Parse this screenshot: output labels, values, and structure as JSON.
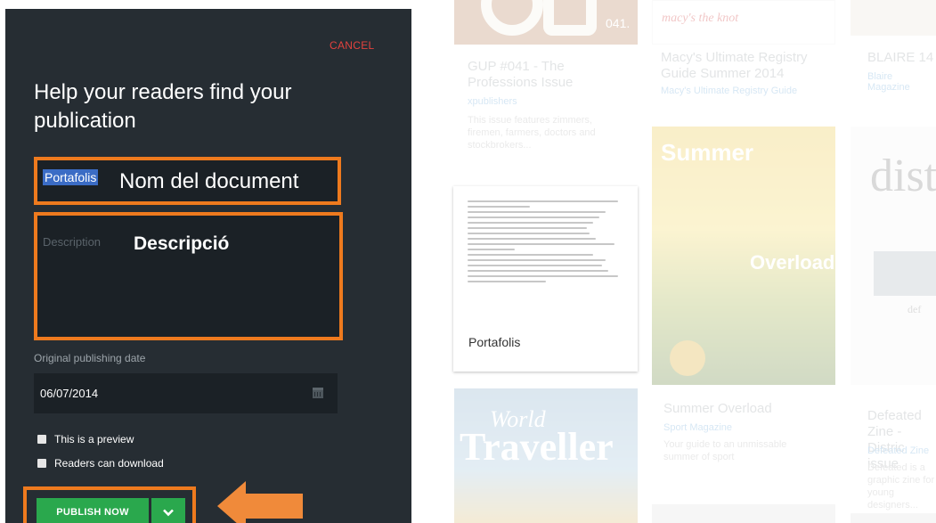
{
  "dialog": {
    "cancel_label": "CANCEL",
    "title": "Help your readers find your publication",
    "name_value": "Portafolis",
    "name_annotation": "Nom del document",
    "description_placeholder": "Description",
    "description_annotation": "Descripció",
    "date_label": "Original publishing date",
    "date_value": "06/07/2014",
    "checkbox_preview": "This is a preview",
    "checkbox_download": "Readers can download",
    "publish_label": "PUBLISH NOW"
  },
  "background_cards": [
    {
      "cover_text": "041.",
      "title": "GUP #041 - The Professions Issue",
      "publisher": "xpublishers",
      "description": "This issue features zimmers, firemen, farmers, doctors and stockbrokers..."
    },
    {
      "cover_text": "macy's the knot",
      "title": "Macy's Ultimate Registry Guide Summer 2014",
      "publisher": "Macy's Ultimate Registry Guide"
    },
    {
      "title": "BLAIRE 14",
      "publisher": "Blaire Magazine"
    },
    {
      "cover_text": "Summer",
      "cover_text2": "Overload",
      "title": "Summer Overload",
      "publisher": "Sport Magazine",
      "description": "Your guide to an unmissable summer of sport"
    },
    {
      "cover_text": "dist",
      "cover_text2": "def",
      "title": "Defeated Zine - Distric issue",
      "publisher": "Defeated Zine",
      "description": "Defeated is a graphic zine for young designers..."
    },
    {
      "cover_text": "World",
      "cover_text2": "Traveller"
    }
  ],
  "document_card": {
    "name": "Portafolis"
  },
  "colors": {
    "panel": "#262d33",
    "cancel": "#e2423e",
    "highlight_border": "#ee7a1e",
    "publish": "#2aa84d",
    "selection": "#3b6cc5"
  }
}
